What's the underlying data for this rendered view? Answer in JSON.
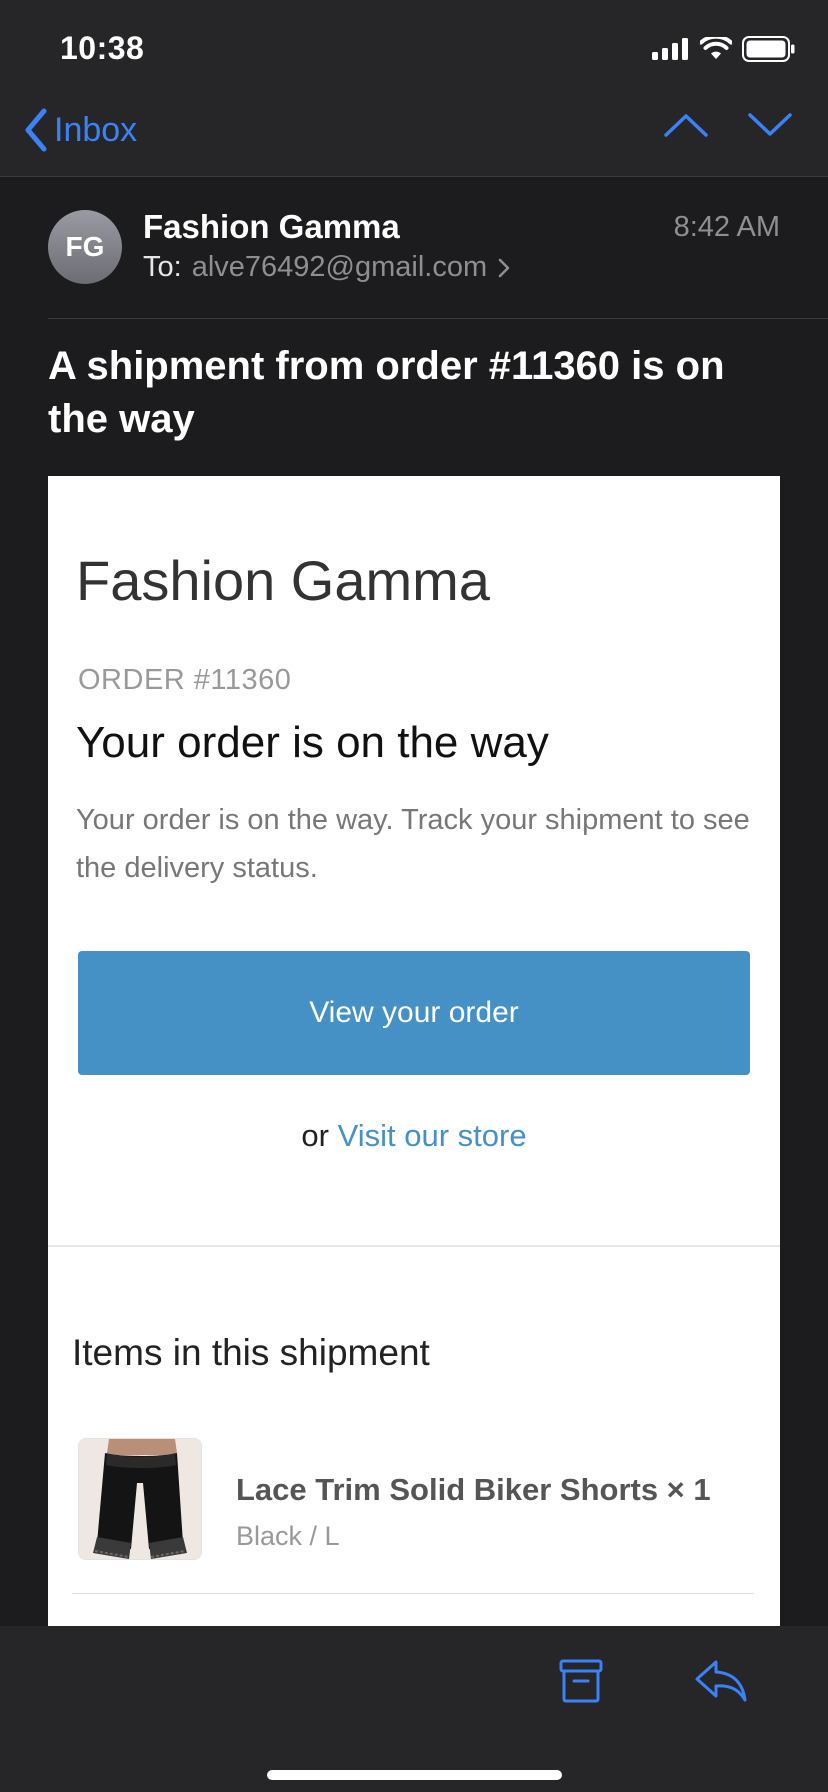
{
  "status_bar": {
    "time": "10:38"
  },
  "nav": {
    "back_label": "Inbox"
  },
  "message": {
    "avatar_initials": "FG",
    "sender": "Fashion Gamma",
    "to_label": "To:",
    "to_address": "alve76492@gmail.com",
    "time": "8:42 AM",
    "subject": "A shipment from order #11360 is on the way"
  },
  "email_body": {
    "brand": "Fashion Gamma",
    "order_number": "ORDER #11360",
    "headline": "Your order is on the way",
    "description": "Your order is on the way. Track your shipment to see the delivery status.",
    "cta_label": "View your order",
    "or_text": "or",
    "store_link": "Visit our store",
    "items_title": "Items in this shipment",
    "items": [
      {
        "name": "Lace Trim Solid Biker Shorts × 1",
        "variant": "Black / L"
      }
    ]
  },
  "colors": {
    "accent": "#3b82f6",
    "button": "#4591c5",
    "background": "#1c1c1e",
    "bar": "#262628"
  },
  "icons": [
    "signal-icon",
    "wifi-icon",
    "battery-icon",
    "chevron-left-icon",
    "chevron-up-icon",
    "chevron-down-icon",
    "chevron-right-icon",
    "archive-icon",
    "reply-icon"
  ]
}
